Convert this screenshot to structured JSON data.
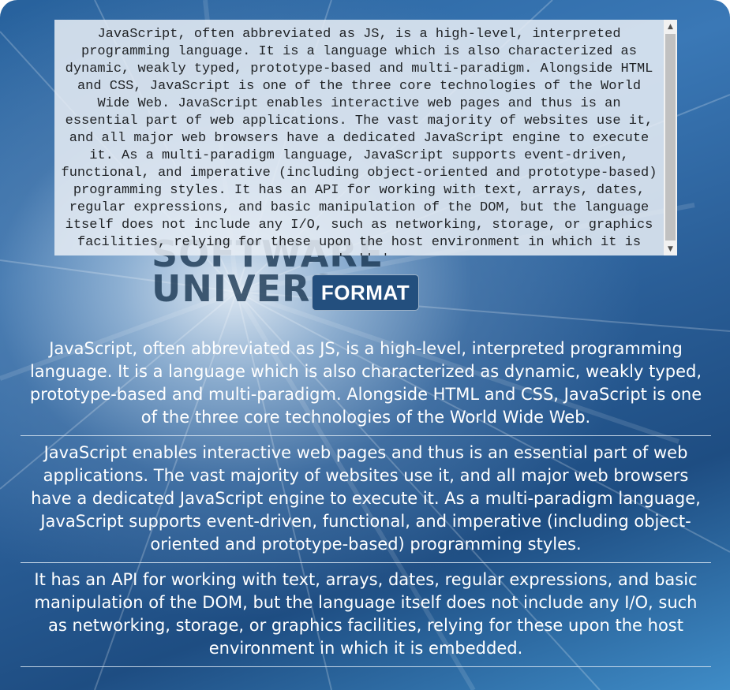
{
  "editor": {
    "text": "JavaScript, often abbreviated as JS, is a high-level, interpreted programming language. It is a language which is also characterized as dynamic, weakly typed, prototype-based and multi-paradigm. Alongside HTML and CSS, JavaScript is one of the three core technologies of the World Wide Web. JavaScript enables interactive web pages and thus is an essential part of web applications. The vast majority of websites use it, and all major web browsers have a dedicated JavaScript engine to execute it. As a multi-paradigm language, JavaScript supports event-driven, functional, and imperative (including object-oriented and prototype-based) programming styles. It has an API for working with text, arrays, dates, regular expressions, and basic manipulation of the DOM, but the language itself does not include any I/O, such as networking, storage, or graphics facilities, relying for these upon the host environment in which it is embedded."
  },
  "scrollbar": {
    "up_arrow": "▲",
    "down_arrow": "▼"
  },
  "watermark": {
    "line1": "SOFTWARE",
    "line2": "UNIVERSITY"
  },
  "format_button": {
    "label": "FORMAT"
  },
  "output": {
    "paragraphs": [
      "JavaScript, often abbreviated as JS, is a high-level, interpreted programming language. It is a language which is also characterized as dynamic, weakly typed, prototype-based and multi-paradigm. Alongside HTML and CSS, JavaScript is one of the three core technologies of the World Wide Web.",
      "JavaScript enables interactive web pages and thus is an essential part of web applications. The vast majority of websites use it, and all major web browsers have a dedicated JavaScript engine to execute it. As a multi-paradigm language, JavaScript supports event-driven, functional, and imperative (including object-oriented and prototype-based) programming styles.",
      "It has an API for working with text, arrays, dates, regular expressions, and basic manipulation of the DOM, but the language itself does not include any I/O, such as networking, storage, or graphics facilities, relying for these upon the host environment in which it is embedded."
    ]
  },
  "colors": {
    "background_blue": "#2a5e97",
    "button_bg": "#234f7e",
    "text_white": "#ffffff",
    "editor_bg": "#e8eef5"
  }
}
